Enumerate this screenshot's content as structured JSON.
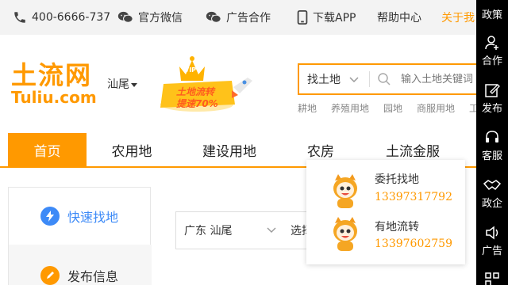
{
  "topbar": {
    "phone": "400-6666-737",
    "wechat": "官方微信",
    "ads": "广告合作",
    "download": "下载APP",
    "help": "帮助中心",
    "about": "关于我"
  },
  "logo": {
    "cn": "土流网",
    "en": "Tuliu.com"
  },
  "city": "汕尾",
  "promo": {
    "badge": "VIP",
    "line1": "土地流转",
    "line2": "提速70%"
  },
  "search": {
    "type": "找土地",
    "placeholder": "输入土地关键词",
    "hot_links": [
      "耕地",
      "养殖用地",
      "园地",
      "商服用地",
      "工"
    ]
  },
  "nav": {
    "items": [
      "首页",
      "农用地",
      "建设用地",
      "农房",
      "土流金服"
    ]
  },
  "left_panel": {
    "quick_find": "快速找地",
    "publish": "发布信息"
  },
  "main": {
    "region_select": "广东 汕尾",
    "second_select": "选择"
  },
  "dropdown": {
    "items": [
      {
        "title": "委托找地",
        "phone": "13397317792"
      },
      {
        "title": "有地流转",
        "phone": "13397602759"
      }
    ]
  },
  "sidebar": {
    "items": [
      "政策",
      "合作",
      "发布",
      "客服",
      "政企",
      "广告"
    ]
  },
  "colors": {
    "accent": "#ff9900",
    "sidebar": "#000000",
    "topbar": "#f3f3f3",
    "quick_icon": "#3d8af7"
  }
}
